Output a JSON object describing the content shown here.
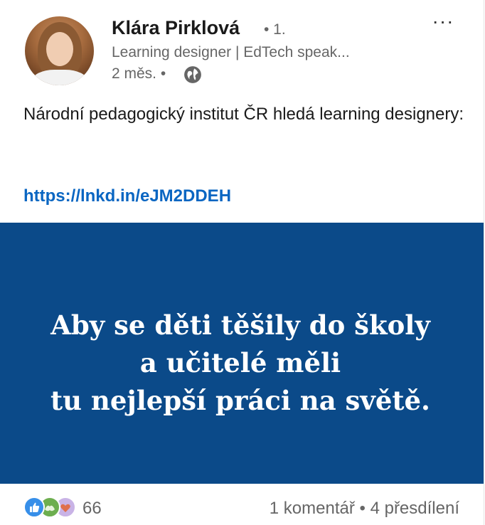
{
  "author": {
    "name": "Klára Pirklová",
    "degree": "• 1.",
    "headline": "Learning designer | EdTech speak...",
    "time_meta": "2 měs. •"
  },
  "post": {
    "text": "Národní pedagogický institut ČR hledá learning designery:",
    "link": "https://lnkd.in/eJM2DDEH"
  },
  "banner": {
    "lines": [
      "Aby se děti těšily do školy",
      "a učitelé měli",
      "tu nejlepší práci na světě."
    ],
    "background_color": "#0b4a89"
  },
  "footer": {
    "reaction_count": "66",
    "comments": "1 komentář",
    "separator": "•",
    "reposts": "4 přesdílení",
    "reaction_icons": [
      "like-icon",
      "support-icon",
      "love-icon"
    ]
  },
  "menu": {
    "more_label": "···"
  },
  "colors": {
    "link": "#0a66c2",
    "secondary_text": "#666666",
    "banner": "#0b4a89"
  }
}
